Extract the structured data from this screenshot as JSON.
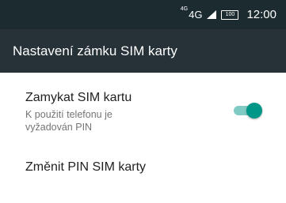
{
  "status_bar": {
    "network_prefix": "4G",
    "network": "4G",
    "signal_icon": "signal-strength-icon",
    "battery_label": "100",
    "time": "12:00"
  },
  "app_bar": {
    "title": "Nastavení zámku SIM karty"
  },
  "settings": {
    "lock_sim": {
      "title": "Zamykat SIM kartu",
      "summary": "K použití telefonu je vyžadován PIN",
      "enabled": true
    },
    "change_pin": {
      "title": "Změnit PIN SIM karty"
    }
  },
  "colors": {
    "status_bar": "#1c2b30",
    "app_bar": "#263238",
    "accent": "#009688",
    "accent_track": "#80cbc4"
  }
}
